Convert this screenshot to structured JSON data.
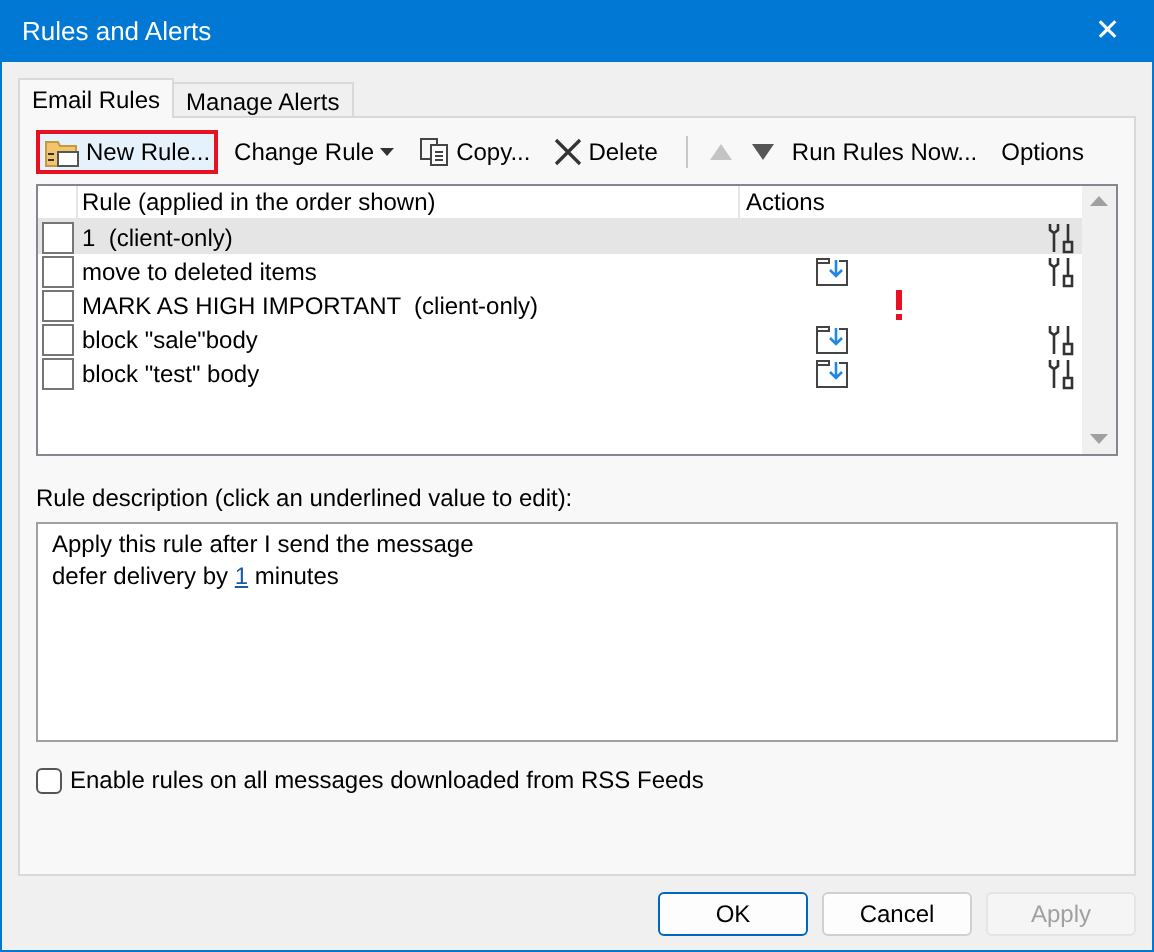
{
  "window": {
    "title": "Rules and Alerts",
    "close": "✕"
  },
  "tabs": [
    {
      "label": "Email Rules",
      "selected": true
    },
    {
      "label": "Manage Alerts",
      "selected": false
    }
  ],
  "toolbar": [
    {
      "kind": "new",
      "label": "New Rule...",
      "focused": true
    },
    {
      "kind": "change",
      "label": "Change Rule",
      "focused": false
    },
    {
      "kind": "copy",
      "label": "Copy...",
      "focused": false
    },
    {
      "kind": "delete",
      "label": "Delete",
      "focused": false
    },
    {
      "kind": "separator"
    },
    {
      "kind": "up",
      "disabled": true
    },
    {
      "kind": "down",
      "disabled": false
    },
    {
      "kind": "run",
      "label": "Run Rules Now...",
      "focused": false
    },
    {
      "kind": "options",
      "label": "Options",
      "focused": false
    }
  ],
  "table": {
    "columns": [
      "Rule (applied in the order shown)",
      "Actions"
    ],
    "rows": [
      {
        "name": "1  (client-only)",
        "checked": false,
        "selected": true,
        "move": false,
        "important": false,
        "settings": true
      },
      {
        "name": "move to deleted items",
        "checked": false,
        "selected": false,
        "move": true,
        "important": false,
        "settings": true
      },
      {
        "name": "MARK AS HIGH IMPORTANT  (client-only)",
        "checked": false,
        "selected": false,
        "move": false,
        "important": true,
        "settings": false
      },
      {
        "name": "block \"sale\"body",
        "checked": false,
        "selected": false,
        "move": true,
        "important": false,
        "settings": true
      },
      {
        "name": "block \"test\" body",
        "checked": false,
        "selected": false,
        "move": true,
        "important": false,
        "settings": true
      }
    ]
  },
  "description": {
    "label": "Rule description (click an underlined value to edit):",
    "lines": [
      [
        {
          "kind": "text",
          "text": "Apply this rule after I send the message"
        }
      ],
      [
        {
          "kind": "text",
          "text": "defer delivery by "
        },
        {
          "kind": "link",
          "text": "1"
        },
        {
          "kind": "text",
          "text": " minutes"
        }
      ]
    ]
  },
  "rss": {
    "label": "Enable rules on all messages downloaded from RSS Feeds",
    "checked": false
  },
  "buttons": [
    {
      "label": "OK",
      "default": true,
      "disabled": false
    },
    {
      "label": "Cancel",
      "default": false,
      "disabled": false
    },
    {
      "label": "Apply",
      "default": false,
      "disabled": true
    }
  ]
}
